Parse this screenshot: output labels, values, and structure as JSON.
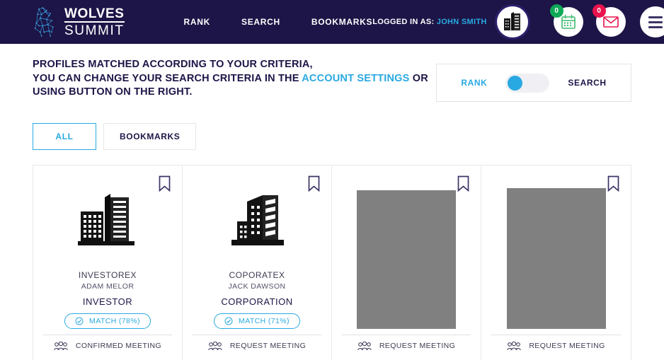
{
  "navbar": {
    "brand": {
      "line1": "WOLVES",
      "line2": "SUMMIT",
      "logo_icon": "wolf-logo-icon"
    },
    "links": [
      {
        "label": "RANK",
        "name": "nav-link-rank"
      },
      {
        "label": "SEARCH",
        "name": "nav-link-search"
      },
      {
        "label": "BOOKMARKS",
        "name": "nav-link-bookmarks"
      }
    ],
    "logged_in_prefix": "LOGGED IN AS:",
    "logged_in_user": "JOHN SMITH",
    "avatar_icon": "company-building-avatar-icon",
    "calendar": {
      "icon": "calendar-icon",
      "count": "0",
      "color": "#0fa958"
    },
    "mail": {
      "icon": "envelope-icon",
      "count": "0",
      "color": "#e8134c"
    },
    "menu_icon": "hamburger-menu-icon"
  },
  "header": {
    "line1": "PROFILES MATCHED ACCORDING TO YOUR CRITERIA,",
    "line2_a": "YOU CAN CHANGE YOUR SEARCH CRITERIA IN THE ",
    "line2_link": "ACCOUNT SETTINGS",
    "line2_b": " OR USING BUTTON ON THE RIGHT.",
    "accent_color": "#29a9e1"
  },
  "rank_search": {
    "rank_label": "RANK",
    "search_label": "SEARCH",
    "toggle_state": "rank",
    "toggle_icon": "toggle-switch-icon"
  },
  "tabs": [
    {
      "label": "ALL",
      "active": true,
      "name": "tab-all"
    },
    {
      "label": "BOOKMARKS",
      "active": false,
      "name": "tab-bookmarks"
    }
  ],
  "cards": [
    {
      "company": "INVESTOREX",
      "person": "ADAM MELOR",
      "role": "INVESTOR",
      "match_label": "MATCH (78%)",
      "match_icon": "check-circle-icon",
      "action_label": "CONFIRMED MEETING",
      "action_icon": "people-group-icon",
      "bookmark_icon": "bookmark-icon",
      "logo_icon": "office-towers-icon",
      "has_image": false
    },
    {
      "company": "COPORATEX",
      "person": "JACK DAWSON",
      "role": "CORPORATION",
      "match_label": "MATCH (71%)",
      "match_icon": "check-circle-icon",
      "action_label": "REQUEST MEETING",
      "action_icon": "people-group-icon",
      "bookmark_icon": "bookmark-icon",
      "logo_icon": "office-building-icon",
      "has_image": false
    },
    {
      "company": "",
      "person": "",
      "role": "",
      "match_label": "",
      "action_label": "REQUEST MEETING",
      "action_icon": "people-group-icon",
      "bookmark_icon": "bookmark-icon",
      "logo_icon": "image-placeholder",
      "has_image": true,
      "placeholder_color": "#808080"
    },
    {
      "company": "",
      "person": "",
      "role": "",
      "match_label": "",
      "action_label": "REQUEST MEETING",
      "action_icon": "people-group-icon",
      "bookmark_icon": "bookmark-icon",
      "logo_icon": "image-placeholder",
      "has_image": true,
      "placeholder_color": "#808080"
    }
  ],
  "colors": {
    "navbar_bg": "#1d1547",
    "accent_blue": "#29a9e1",
    "text_dark": "#1d1547",
    "border_light": "#e8e8ec"
  }
}
